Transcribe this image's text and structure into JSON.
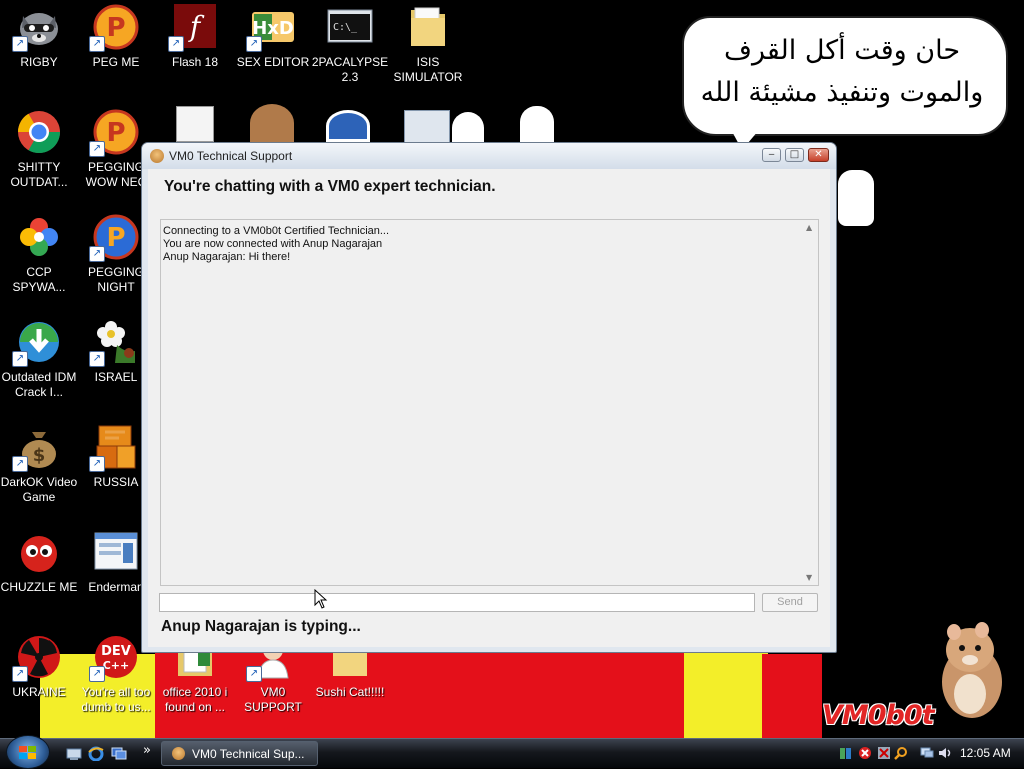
{
  "desktop": {
    "speech_bubble": {
      "text": "حان وقت أكل القرف\nوالموت وتنفيذ مشيئة الله"
    },
    "logo_text": "VM0b0t",
    "icons": [
      {
        "label": "RIGBY",
        "icon": "raccoon-icon"
      },
      {
        "label": "PEG ME",
        "icon": "peggle-icon"
      },
      {
        "label": "Flash 18",
        "icon": "flash-icon"
      },
      {
        "label": "SEX EDITOR",
        "icon": "hex-editor-icon"
      },
      {
        "label": "2PACALYPSE 2.3",
        "icon": "terminal-icon"
      },
      {
        "label": "ISIS SIMULATOR",
        "icon": "folder-icon"
      },
      {
        "label": "SHITTY OUTDAT...",
        "icon": "chrome-icon"
      },
      {
        "label": "PEGGING WOW NEC",
        "icon": "peggle-icon"
      },
      {
        "label": "CCP SPYWA...",
        "icon": "photos-icon"
      },
      {
        "label": "PEGGING NIGHT",
        "icon": "peggle-night-icon"
      },
      {
        "label": "Outdated IDM Crack I...",
        "icon": "download-manager-icon"
      },
      {
        "label": "ISRAEL",
        "icon": "flower-icon"
      },
      {
        "label": "DarkOK Video Game",
        "icon": "money-bag-icon"
      },
      {
        "label": "RUSSIA",
        "icon": "blocks-icon"
      },
      {
        "label": "CHUZZLE ME",
        "icon": "chuzzle-icon"
      },
      {
        "label": "Enderman",
        "icon": "window-app-icon"
      },
      {
        "label": "UKRAINE",
        "icon": "radiation-icon"
      },
      {
        "label": "You're all too dumb to us...",
        "icon": "dev-cpp-icon"
      },
      {
        "label": "office 2010 i found on ...",
        "icon": "office-icon"
      },
      {
        "label": "VM0 SUPPORT",
        "icon": "doctor-icon"
      },
      {
        "label": "Sushi Cat!!!!!",
        "icon": "folder-icon"
      }
    ]
  },
  "window": {
    "title": "VM0 Technical Support",
    "heading": "You're chatting with a VM0 expert technician.",
    "messages": [
      "Connecting to a VM0b0t Certified Technician...",
      "You are now connected with Anup Nagarajan",
      "Anup Nagarajan: Hi there!"
    ],
    "input_value": "",
    "send_label": "Send",
    "status": "Anup Nagarajan is typing...",
    "controls": {
      "minimize": "‒",
      "maximize": "□",
      "close": "✕"
    }
  },
  "taskbar": {
    "task_label": "VM0 Technical Sup...",
    "clock": "12:05 AM",
    "quicklaunch_icons": [
      "show-desktop-icon",
      "internet-explorer-icon",
      "switch-windows-icon"
    ],
    "more_glyph": "»",
    "tray_icons": [
      "people-icon",
      "security-alert-icon",
      "network-icon",
      "search-icon",
      "monitor-icon",
      "volume-icon"
    ]
  },
  "colors": {
    "background_red": "#e4101a",
    "background_yellow": "#f3ee29",
    "logo_red": "#e22525"
  }
}
